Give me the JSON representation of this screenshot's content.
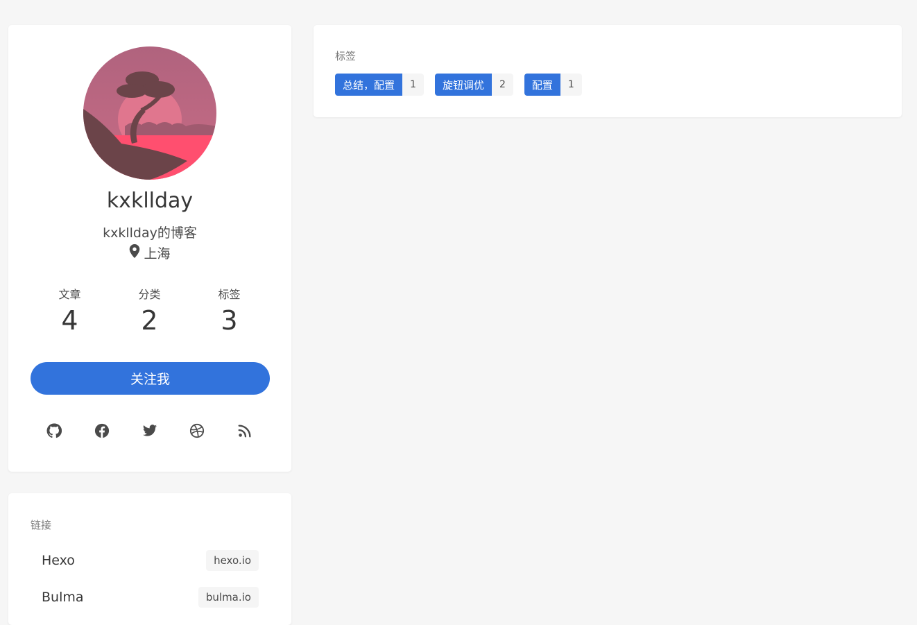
{
  "profile": {
    "name": "kxkllday",
    "subtitle": "kxkllday的博客",
    "location": "上海",
    "stats": [
      {
        "label": "文章",
        "value": "4"
      },
      {
        "label": "分类",
        "value": "2"
      },
      {
        "label": "标签",
        "value": "3"
      }
    ],
    "follow_label": "关注我",
    "social_icons": [
      "github-icon",
      "facebook-icon",
      "twitter-icon",
      "dribbble-icon",
      "rss-icon"
    ]
  },
  "links": {
    "heading": "链接",
    "items": [
      {
        "name": "Hexo",
        "host": "hexo.io"
      },
      {
        "name": "Bulma",
        "host": "bulma.io"
      }
    ]
  },
  "tags": {
    "heading": "标签",
    "items": [
      {
        "name": "总结，配置",
        "count": "1"
      },
      {
        "name": "旋钮调优",
        "count": "2"
      },
      {
        "name": "配置",
        "count": "1"
      }
    ]
  },
  "colors": {
    "accent": "#3273dc",
    "background": "#f6f6f6",
    "card": "#ffffff"
  }
}
